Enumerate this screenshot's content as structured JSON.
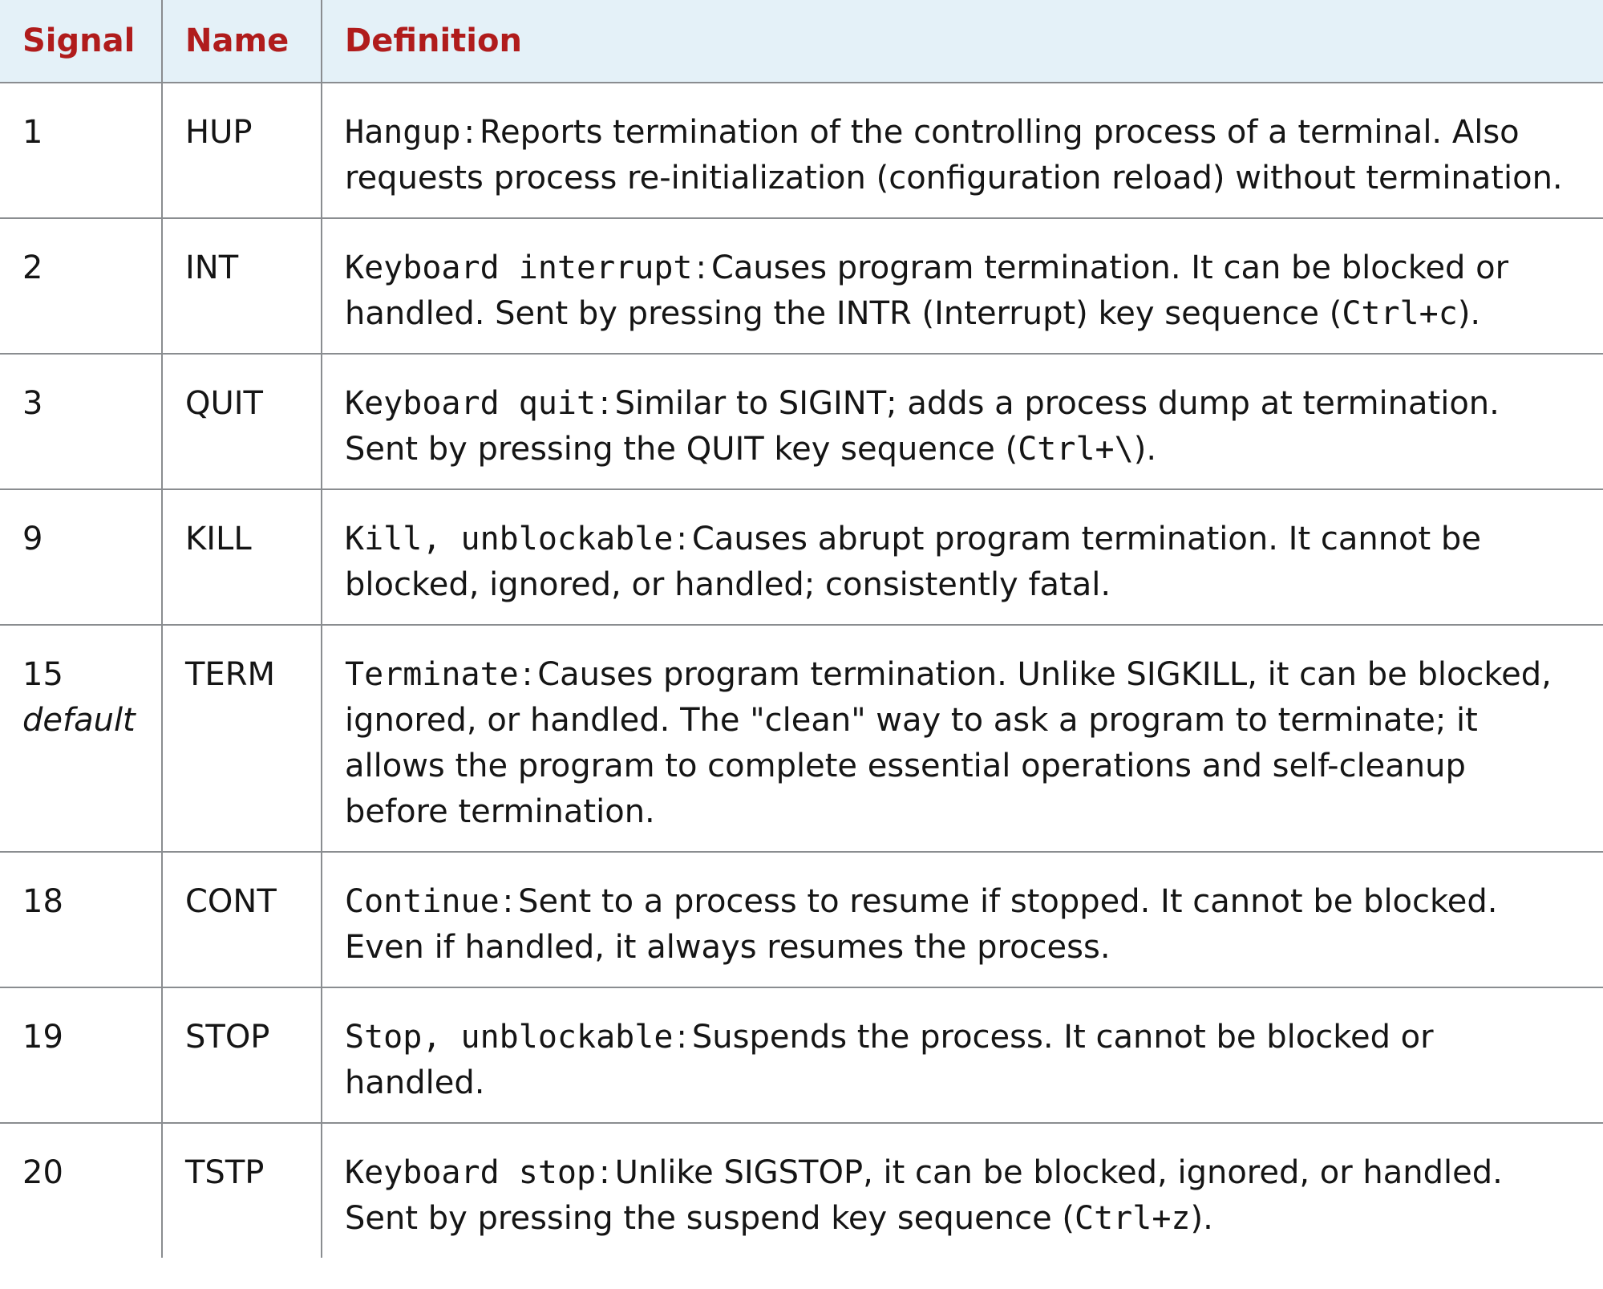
{
  "headers": {
    "signal": "Signal",
    "name": "Name",
    "definition": "Definition"
  },
  "rows": [
    {
      "signal": "1",
      "name": "HUP",
      "term": "Hangup",
      "separator": ":",
      "text": "Reports termination of the controlling process of a terminal. Also requests process re-initialization (configuration reload) without termination."
    },
    {
      "signal": "2",
      "name": "INT",
      "term": "Keyboard interrupt",
      "separator": ":",
      "text": "Causes program termination. It can be blocked or handled. Sent by pressing the INTR (Interrupt) key sequence (",
      "key": "Ctrl+c",
      "close": ")."
    },
    {
      "signal": "3",
      "name": "QUIT",
      "term": "Keyboard quit",
      "separator": ":",
      "text": "Similar to SIGINT; adds a process dump at termination. Sent by pressing the QUIT key sequence (",
      "key": "Ctrl+\\",
      "close": ")."
    },
    {
      "signal": "9",
      "name": "KILL",
      "term": "Kill, unblockable",
      "separator": ":",
      "text": "Causes abrupt program termination. It cannot be blocked, ignored, or handled; consistently fatal."
    },
    {
      "signal": "15",
      "signal_note": "default",
      "name": "TERM",
      "term": "Terminate",
      "separator": ":",
      "text": "Causes program termination. Unlike SIGKILL, it can be blocked, ignored, or handled. The \"clean\" way to ask a program to terminate; it allows the program to complete essential operations and self-cleanup before termination."
    },
    {
      "signal": "18",
      "name": "CONT",
      "term": "Continue",
      "separator": ":",
      "text": "Sent to a process to resume if stopped. It cannot be blocked. Even if handled, it always resumes the process."
    },
    {
      "signal": "19",
      "name": "STOP",
      "term": "Stop, unblockable",
      "separator": ":",
      "text": "Suspends the process. It cannot be blocked or handled."
    },
    {
      "signal": "20",
      "name": "TSTP",
      "term": "Keyboard stop",
      "separator": ":",
      "text": "Unlike SIGSTOP, it can be blocked, ignored, or handled. Sent by pressing the suspend key sequence (",
      "key": "Ctrl+z",
      "close": ")."
    }
  ],
  "colors": {
    "header_bg": "#e4f1f8",
    "header_text": "#b01c1c",
    "border": "#8a8d90",
    "body_text": "#151515"
  }
}
